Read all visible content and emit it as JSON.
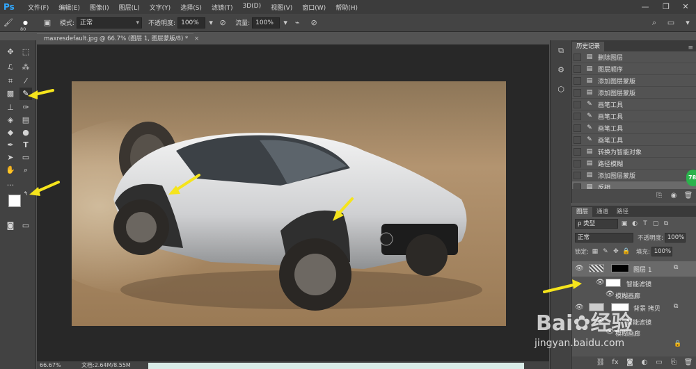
{
  "app": {
    "logo": "Ps"
  },
  "menu": [
    "文件(F)",
    "编辑(E)",
    "图像(I)",
    "图层(L)",
    "文字(Y)",
    "选择(S)",
    "滤镜(T)",
    "3D(D)",
    "视图(V)",
    "窗口(W)",
    "帮助(H)"
  ],
  "window_controls": {
    "minimize": "—",
    "restore": "❐",
    "close": "✕"
  },
  "options": {
    "brush_size": "80",
    "mode_label": "模式:",
    "mode_value": "正常",
    "opacity_label": "不透明度:",
    "opacity_value": "100%",
    "flow_label": "流量:",
    "flow_value": "100%"
  },
  "document": {
    "tab_title": "maxresdefault.jpg @ 66.7% (图层 1, 图层蒙版/8) *",
    "tab_close": "×",
    "zoom": "66.67%",
    "doc_info": "文档:2.64M/8.55M"
  },
  "history": {
    "tab": "历史记录",
    "items": [
      {
        "label": "删除图层",
        "icon": "doc-icon"
      },
      {
        "label": "图层顺序",
        "icon": "doc-icon"
      },
      {
        "label": "添加图层蒙版",
        "icon": "doc-icon"
      },
      {
        "label": "添加图层蒙版",
        "icon": "doc-icon"
      },
      {
        "label": "画笔工具",
        "icon": "brush-icon"
      },
      {
        "label": "画笔工具",
        "icon": "brush-icon"
      },
      {
        "label": "画笔工具",
        "icon": "brush-icon"
      },
      {
        "label": "画笔工具",
        "icon": "brush-icon"
      },
      {
        "label": "转换为智能对象",
        "icon": "doc-icon"
      },
      {
        "label": "路径模糊",
        "icon": "doc-icon"
      },
      {
        "label": "添加图层蒙版",
        "icon": "doc-icon"
      },
      {
        "label": "反相",
        "icon": "doc-icon",
        "active": true
      }
    ]
  },
  "layers": {
    "tabs": [
      "图层",
      "通道",
      "路径"
    ],
    "filter_kind": "ρ 类型",
    "blend_mode": "正常",
    "opacity_label": "不透明度:",
    "opacity_value": "100%",
    "lock_label": "锁定:",
    "fill_label": "填充:",
    "fill_value": "100%",
    "items": [
      {
        "name": "图层 1",
        "type": "layer"
      },
      {
        "name": "智能滤镜",
        "type": "smart-filter"
      },
      {
        "name": "模糊画廊",
        "type": "filter"
      },
      {
        "name": "背景 拷贝",
        "type": "layer"
      },
      {
        "name": "智能滤镜",
        "type": "smart-filter"
      },
      {
        "name": "模糊画廊",
        "type": "filter"
      }
    ]
  },
  "watermark": {
    "brand": "Bai",
    "brand2": "经验",
    "url": "jingyan.baidu.com"
  },
  "badge": "78",
  "colors": {
    "accent_arrow": "#f5e41c",
    "ps_blue": "#31a8ff",
    "badge_green": "#2bb24c"
  }
}
